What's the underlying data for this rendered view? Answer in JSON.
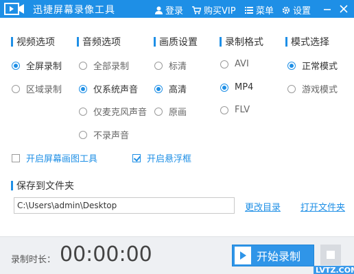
{
  "titlebar": {
    "title": "迅捷屏幕录像工具",
    "login": "登录",
    "buy_vip": "购买VIP",
    "menu": "菜单",
    "settings": "设置"
  },
  "sections": {
    "video": {
      "title": "视频选项",
      "options": [
        "全屏录制",
        "区域录制"
      ],
      "selected": "全屏录制"
    },
    "audio": {
      "title": "音频选项",
      "options": [
        "全部录制",
        "仅系统声音",
        "仅麦克风声音",
        "不录声音"
      ],
      "selected": "仅系统声音"
    },
    "quality": {
      "title": "画质设置",
      "options": [
        "标清",
        "高清",
        "原画"
      ],
      "selected": "高清"
    },
    "format": {
      "title": "录制格式",
      "options": [
        "AVI",
        "MP4",
        "FLV"
      ],
      "selected": "MP4"
    },
    "mode": {
      "title": "模式选择",
      "options": [
        "正常模式",
        "游戏模式"
      ],
      "selected": "正常模式"
    }
  },
  "checkboxes": {
    "paint_tool": {
      "label": "开启屏幕画图工具",
      "checked": false
    },
    "floating_window": {
      "label": "开启悬浮框",
      "checked": true
    }
  },
  "save": {
    "title": "保存到文件夹",
    "path": "C:\\Users\\admin\\Desktop",
    "change_dir": "更改目录",
    "open_folder": "打开文件夹"
  },
  "footer": {
    "duration_label": "录制时长：",
    "duration": "00:00:00",
    "start_button": "开始录制",
    "watermark": "LVTZ.COM"
  },
  "colors": {
    "accent": "#1e8fe6",
    "footer_bg": "#eef0f3"
  }
}
